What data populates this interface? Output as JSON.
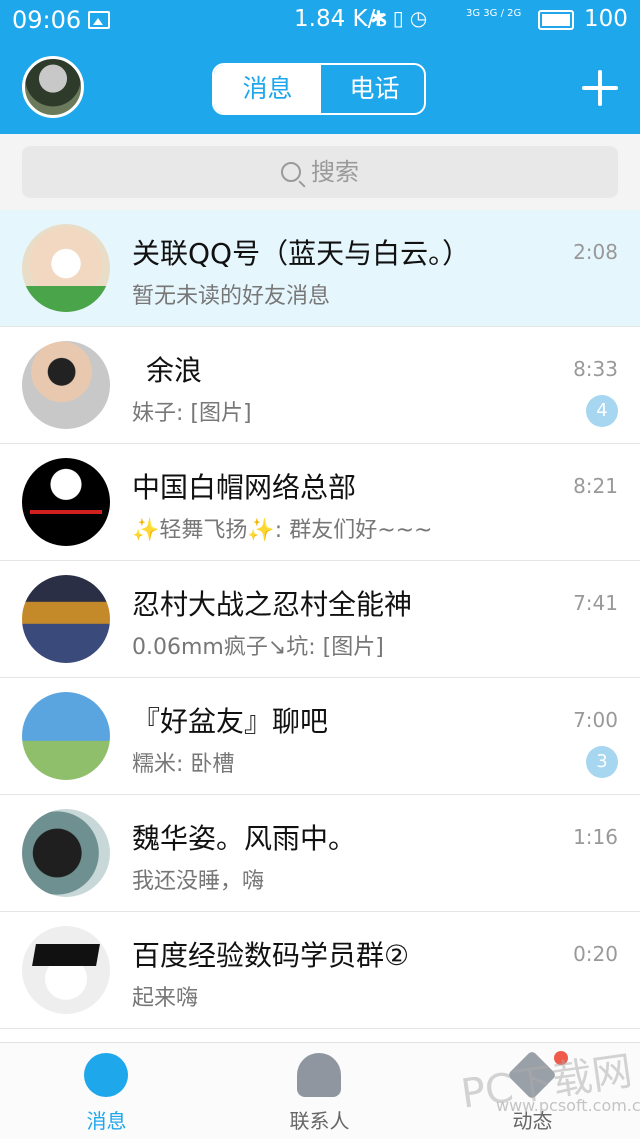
{
  "status_bar": {
    "time": "09:06",
    "speed": "1.84 K/s",
    "net_text": "3G 3G / 2G",
    "battery": "100"
  },
  "header": {
    "tabs": [
      {
        "label": "消息",
        "active": true
      },
      {
        "label": "电话",
        "active": false
      }
    ],
    "accent_color": "#1fa7ec"
  },
  "search": {
    "placeholder": "搜索"
  },
  "conversations": [
    {
      "name": "关联QQ号（蓝天与白云。）",
      "preview": "暂无未读的好友消息",
      "time": "2:08",
      "badge": "",
      "pinned": true
    },
    {
      "name": "余浪",
      "preview": "妹子: [图片]",
      "time": "8:33",
      "badge": "4",
      "pinned": false
    },
    {
      "name": "中国白帽网络总部",
      "preview": "✨轻舞飞扬✨: 群友们好~~~",
      "time": "8:21",
      "badge": "",
      "pinned": false
    },
    {
      "name": "忍村大战之忍村全能神",
      "preview": "0.06mm疯子↘坑: [图片]",
      "time": "7:41",
      "badge": "",
      "pinned": false
    },
    {
      "name": "『好盆友』聊吧",
      "preview": "糯米: 卧槽",
      "time": "7:00",
      "badge": "3",
      "pinned": false
    },
    {
      "name": "魏华姿。风雨中。",
      "preview": "我还没睡，嗨",
      "time": "1:16",
      "badge": "",
      "pinned": false
    },
    {
      "name": "百度经验数码学员群②",
      "preview": "起来嗨",
      "time": "0:20",
      "badge": "",
      "pinned": false
    }
  ],
  "tabbar": {
    "items": [
      {
        "label": "消息",
        "icon": "chat-bubble-icon",
        "active": true
      },
      {
        "label": "联系人",
        "icon": "contact-person-icon",
        "active": false
      },
      {
        "label": "动态",
        "icon": "star-icon",
        "active": false
      }
    ]
  },
  "watermark": {
    "main": "PC下载网",
    "url": "www.pcsoft.com.cn"
  }
}
